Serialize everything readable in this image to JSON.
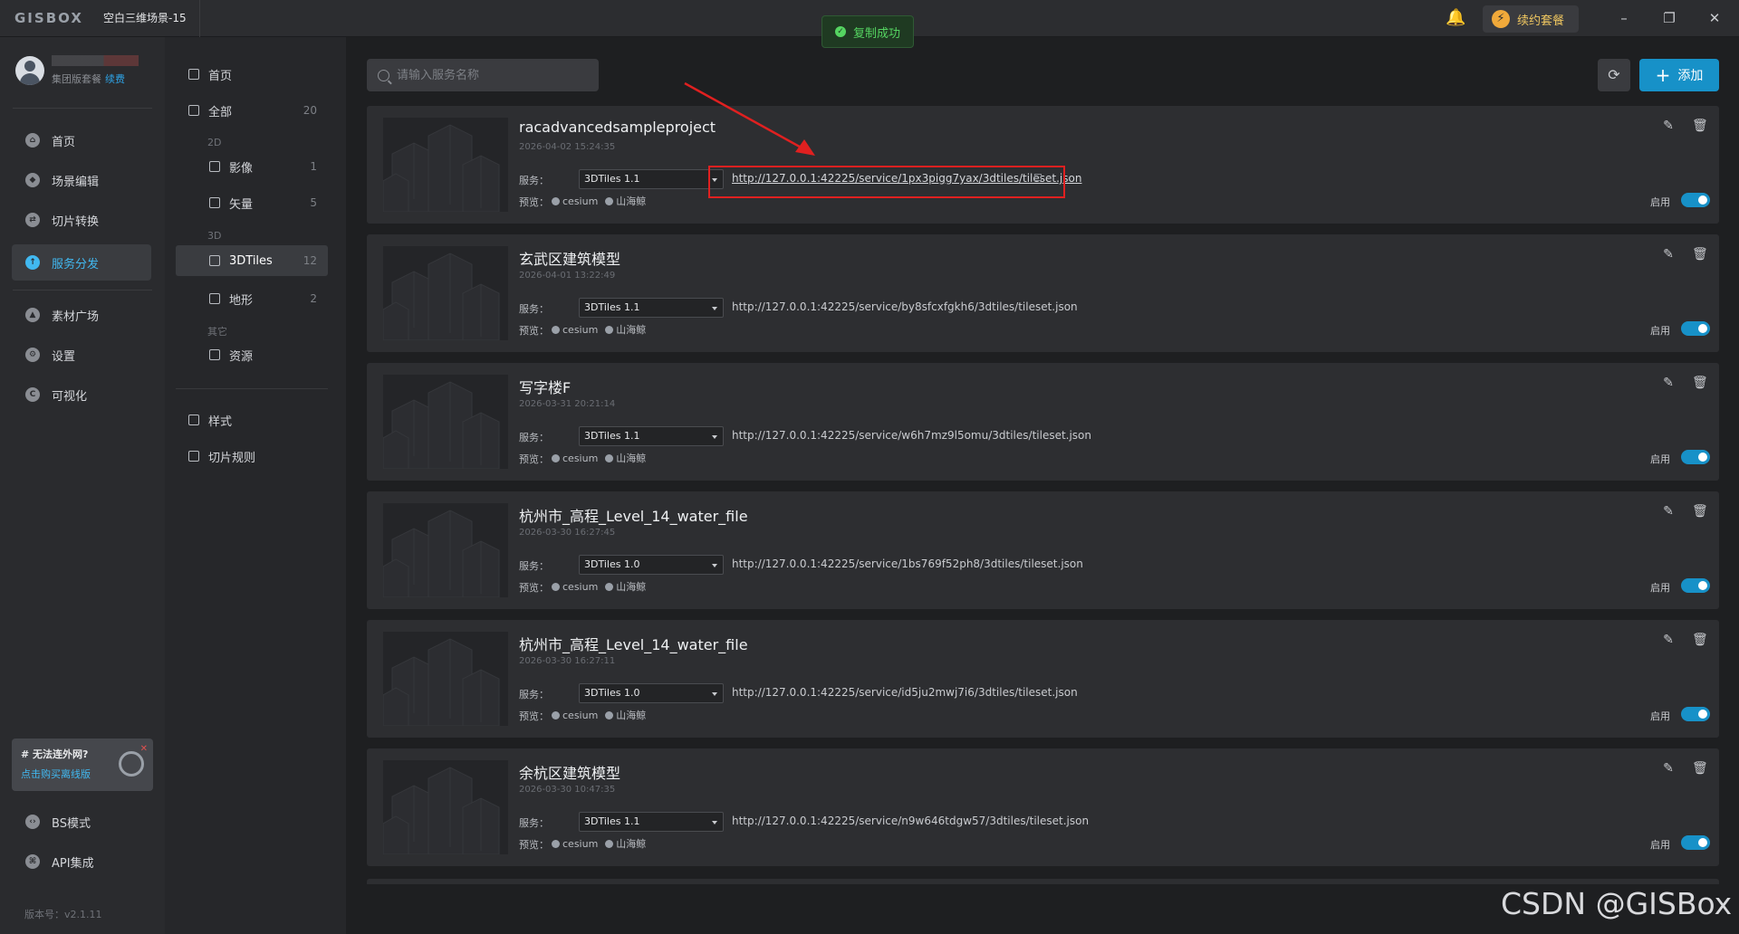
{
  "app": {
    "logo": "GISBOX",
    "title": "空白三维场景-15"
  },
  "toast": {
    "text": "复制成功"
  },
  "header": {
    "renew_label": "续约套餐",
    "minimize": "–",
    "restore": "❐",
    "close": "✕"
  },
  "user": {
    "plan": "集团版套餐",
    "renew_link": "续费"
  },
  "nav": [
    {
      "label": "首页",
      "icon": "home-icon",
      "active": false
    },
    {
      "label": "场景编辑",
      "icon": "cube-icon",
      "active": false
    },
    {
      "label": "切片转换",
      "icon": "convert-icon",
      "active": false
    },
    {
      "label": "服务分发",
      "icon": "upload-cloud-icon",
      "active": true
    },
    {
      "label": "素材广场",
      "icon": "image-icon",
      "active": false
    },
    {
      "label": "设置",
      "icon": "gear-icon",
      "active": false
    },
    {
      "label": "可视化",
      "icon": "visual-icon",
      "active": false
    }
  ],
  "offline": {
    "title": "# 无法连外网?",
    "link": "点击购买离线版"
  },
  "bottom_nav": [
    {
      "label": "BS模式",
      "icon": "code-icon"
    },
    {
      "label": "API集成",
      "icon": "api-icon"
    }
  ],
  "version": "版本号：v2.1.11",
  "categories": {
    "home": "首页",
    "all": {
      "label": "全部",
      "count": "20"
    },
    "group_2d": "2D",
    "imagery": {
      "label": "影像",
      "count": "1"
    },
    "vector": {
      "label": "矢量",
      "count": "5"
    },
    "group_3d": "3D",
    "tiles3d": {
      "label": "3DTiles",
      "count": "12"
    },
    "terrain": {
      "label": "地形",
      "count": "2"
    },
    "group_other": "其它",
    "resource": {
      "label": "资源"
    },
    "style": "样式",
    "tile_rules": "切片规则"
  },
  "search": {
    "placeholder": "请输入服务名称"
  },
  "add_label": "添加",
  "labels": {
    "service": "服务：",
    "preview": "预览：",
    "cesium": "cesium",
    "shanhaijing": "山海鲸",
    "enable": "启用"
  },
  "services": [
    {
      "name": "racadvancedsampleproject",
      "date": "2026-04-02 15:24:35",
      "version": "3DTiles 1.1",
      "url": "http://127.0.0.1:42225/service/1px3pigg7yax/3dtiles/tileset.json",
      "enabled": true
    },
    {
      "name": "玄武区建筑模型",
      "date": "2026-04-01 13:22:49",
      "version": "3DTiles 1.1",
      "url": "http://127.0.0.1:42225/service/by8sfcxfgkh6/3dtiles/tileset.json",
      "enabled": true
    },
    {
      "name": "写字楼F",
      "date": "2026-03-31 20:21:14",
      "version": "3DTiles 1.1",
      "url": "http://127.0.0.1:42225/service/w6h7mz9l5omu/3dtiles/tileset.json",
      "enabled": true
    },
    {
      "name": "杭州市_高程_Level_14_water_file",
      "date": "2026-03-30 16:27:45",
      "version": "3DTiles 1.0",
      "url": "http://127.0.0.1:42225/service/1bs769f52ph8/3dtiles/tileset.json",
      "enabled": true
    },
    {
      "name": "杭州市_高程_Level_14_water_file",
      "date": "2026-03-30 16:27:11",
      "version": "3DTiles 1.0",
      "url": "http://127.0.0.1:42225/service/id5ju2mwj7i6/3dtiles/tileset.json",
      "enabled": true
    },
    {
      "name": "余杭区建筑模型",
      "date": "2026-03-30 10:47:35",
      "version": "3DTiles 1.1",
      "url": "http://127.0.0.1:42225/service/n9w646tdgw57/3dtiles/tileset.json",
      "enabled": true
    }
  ],
  "watermark": "CSDN @GISBox",
  "colors": {
    "accent": "#1791c8",
    "active_nav": "#41b8f0",
    "toast_green": "#55d461",
    "highlight_red": "#e02020"
  }
}
